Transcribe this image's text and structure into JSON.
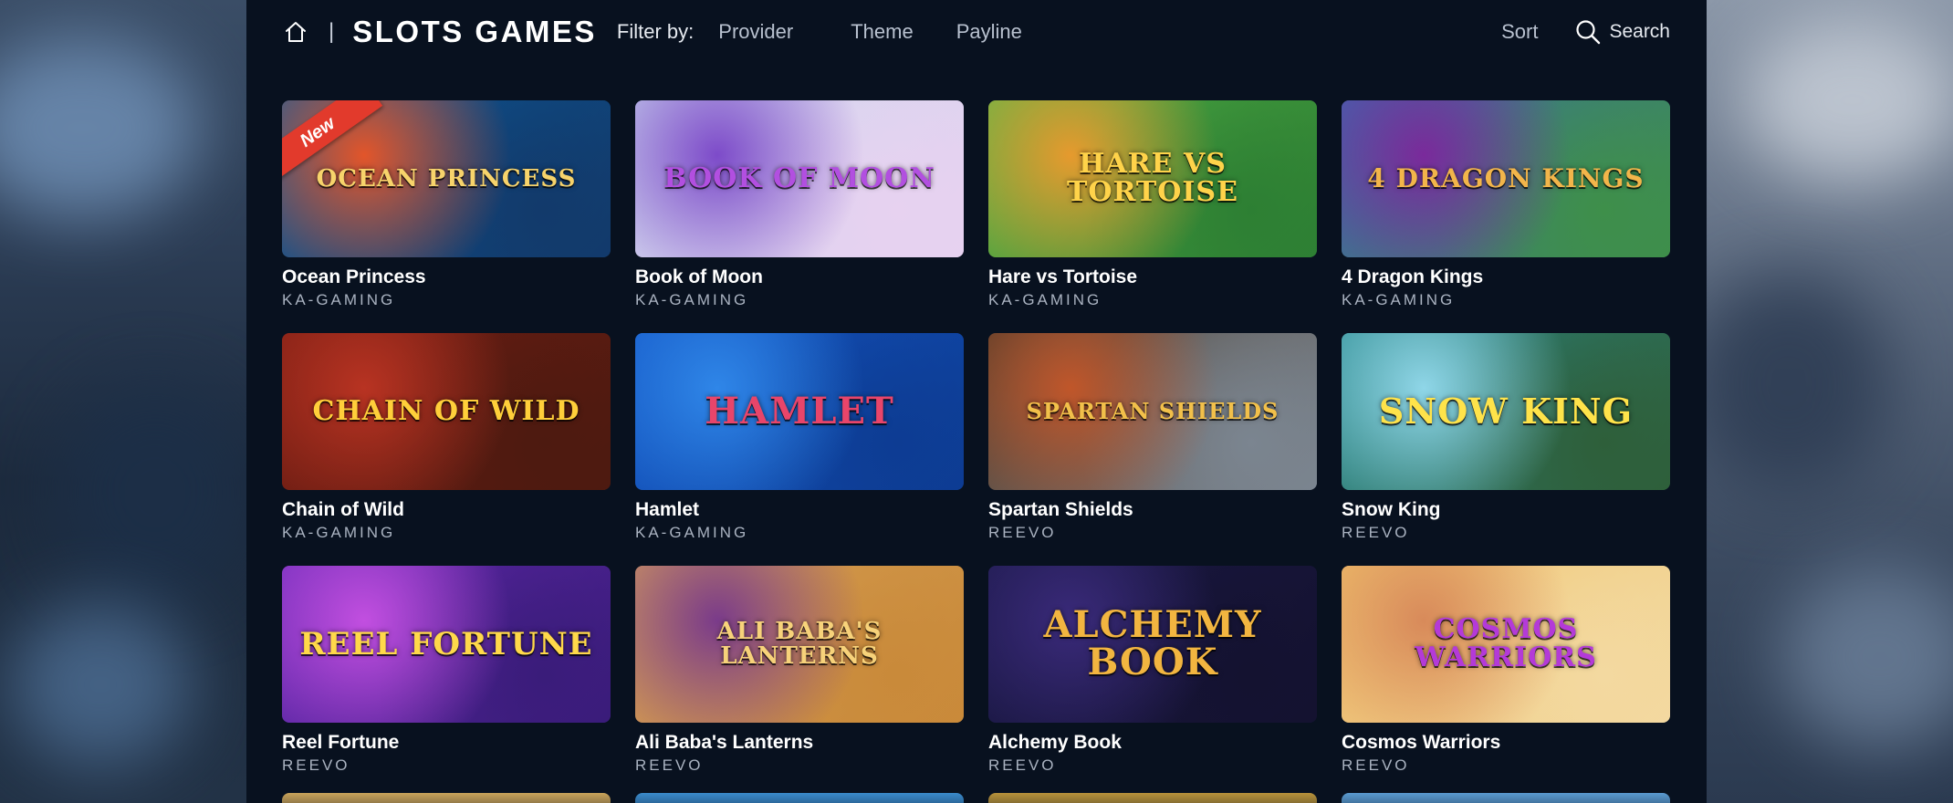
{
  "header": {
    "title": "SLOTS GAMES",
    "separator": "|",
    "filter_label": "Filter by:",
    "filters": [
      "Provider",
      "Theme",
      "Payline"
    ],
    "sort_label": "Sort",
    "search_label": "Search"
  },
  "games": [
    {
      "name": "Ocean Princess",
      "provider": "KA-GAMING",
      "badge": "New",
      "logo": "OCEAN PRINCESS",
      "colors": [
        "#0b5d9e",
        "#e2552a",
        "#123a6b"
      ],
      "logo_color": "#f7d36b"
    },
    {
      "name": "Book of Moon",
      "provider": "KA-GAMING",
      "logo": "Book of Moon",
      "colors": [
        "#c9d7ee",
        "#7d4bc9",
        "#e7d2f0"
      ],
      "logo_color": "#b24fe0"
    },
    {
      "name": "Hare vs Tortoise",
      "provider": "KA-GAMING",
      "logo": "HARE VS TORTOISE",
      "colors": [
        "#59b848",
        "#e69a2e",
        "#2d7f33"
      ],
      "logo_color": "#ffd34a"
    },
    {
      "name": "4 Dragon Kings",
      "provider": "KA-GAMING",
      "logo": "4 DRAGON KINGS",
      "colors": [
        "#3a6bb0",
        "#7a2a9b",
        "#3e8f4a"
      ],
      "logo_color": "#f2b54a"
    },
    {
      "name": "Chain of Wild",
      "provider": "KA-GAMING",
      "logo": "Chain of Wild",
      "colors": [
        "#7a1e14",
        "#b83322",
        "#4d1a10"
      ],
      "logo_color": "#ffcf3a"
    },
    {
      "name": "Hamlet",
      "provider": "KA-GAMING",
      "logo": "HAMLET",
      "colors": [
        "#1559c9",
        "#2f86e8",
        "#0d3c93"
      ],
      "logo_color": "#e8456a"
    },
    {
      "name": "Spartan Shields",
      "provider": "REEVO",
      "logo": "SPARTAN SHIELDS",
      "colors": [
        "#4a3a2a",
        "#c0562a",
        "#7b8590"
      ],
      "logo_color": "#f2c04a"
    },
    {
      "name": "Snow King",
      "provider": "REEVO",
      "logo": "SNOW KING",
      "colors": [
        "#2a8a8f",
        "#8fd6e8",
        "#2e5f3a"
      ],
      "logo_color": "#ffe34a"
    },
    {
      "name": "Reel Fortune",
      "provider": "REEVO",
      "logo": "REEL FORTUNE",
      "colors": [
        "#6a2bb8",
        "#c24fe0",
        "#3a1c7a"
      ],
      "logo_color": "#ffd84a"
    },
    {
      "name": "Ali Baba's Lanterns",
      "provider": "REEVO",
      "logo": "Ali Baba's Lanterns",
      "colors": [
        "#d9a35a",
        "#7a3b8a",
        "#c98a3a"
      ],
      "logo_color": "#f7d27a"
    },
    {
      "name": "Alchemy Book",
      "provider": "REEVO",
      "logo": "ALCHEMY BOOK",
      "colors": [
        "#1c1a4a",
        "#3a2a7a",
        "#141230"
      ],
      "logo_color": "#f2b540"
    },
    {
      "name": "Cosmos Warriors",
      "provider": "REEVO",
      "logo": "COSMOS WARRIORS",
      "colors": [
        "#f0c26a",
        "#d88a5a",
        "#f3d9a0"
      ],
      "logo_color": "#b43ad8"
    }
  ],
  "peek_colors": [
    "#c9a35a",
    "#3a8acb",
    "#b8923a",
    "#5a9ad0"
  ]
}
